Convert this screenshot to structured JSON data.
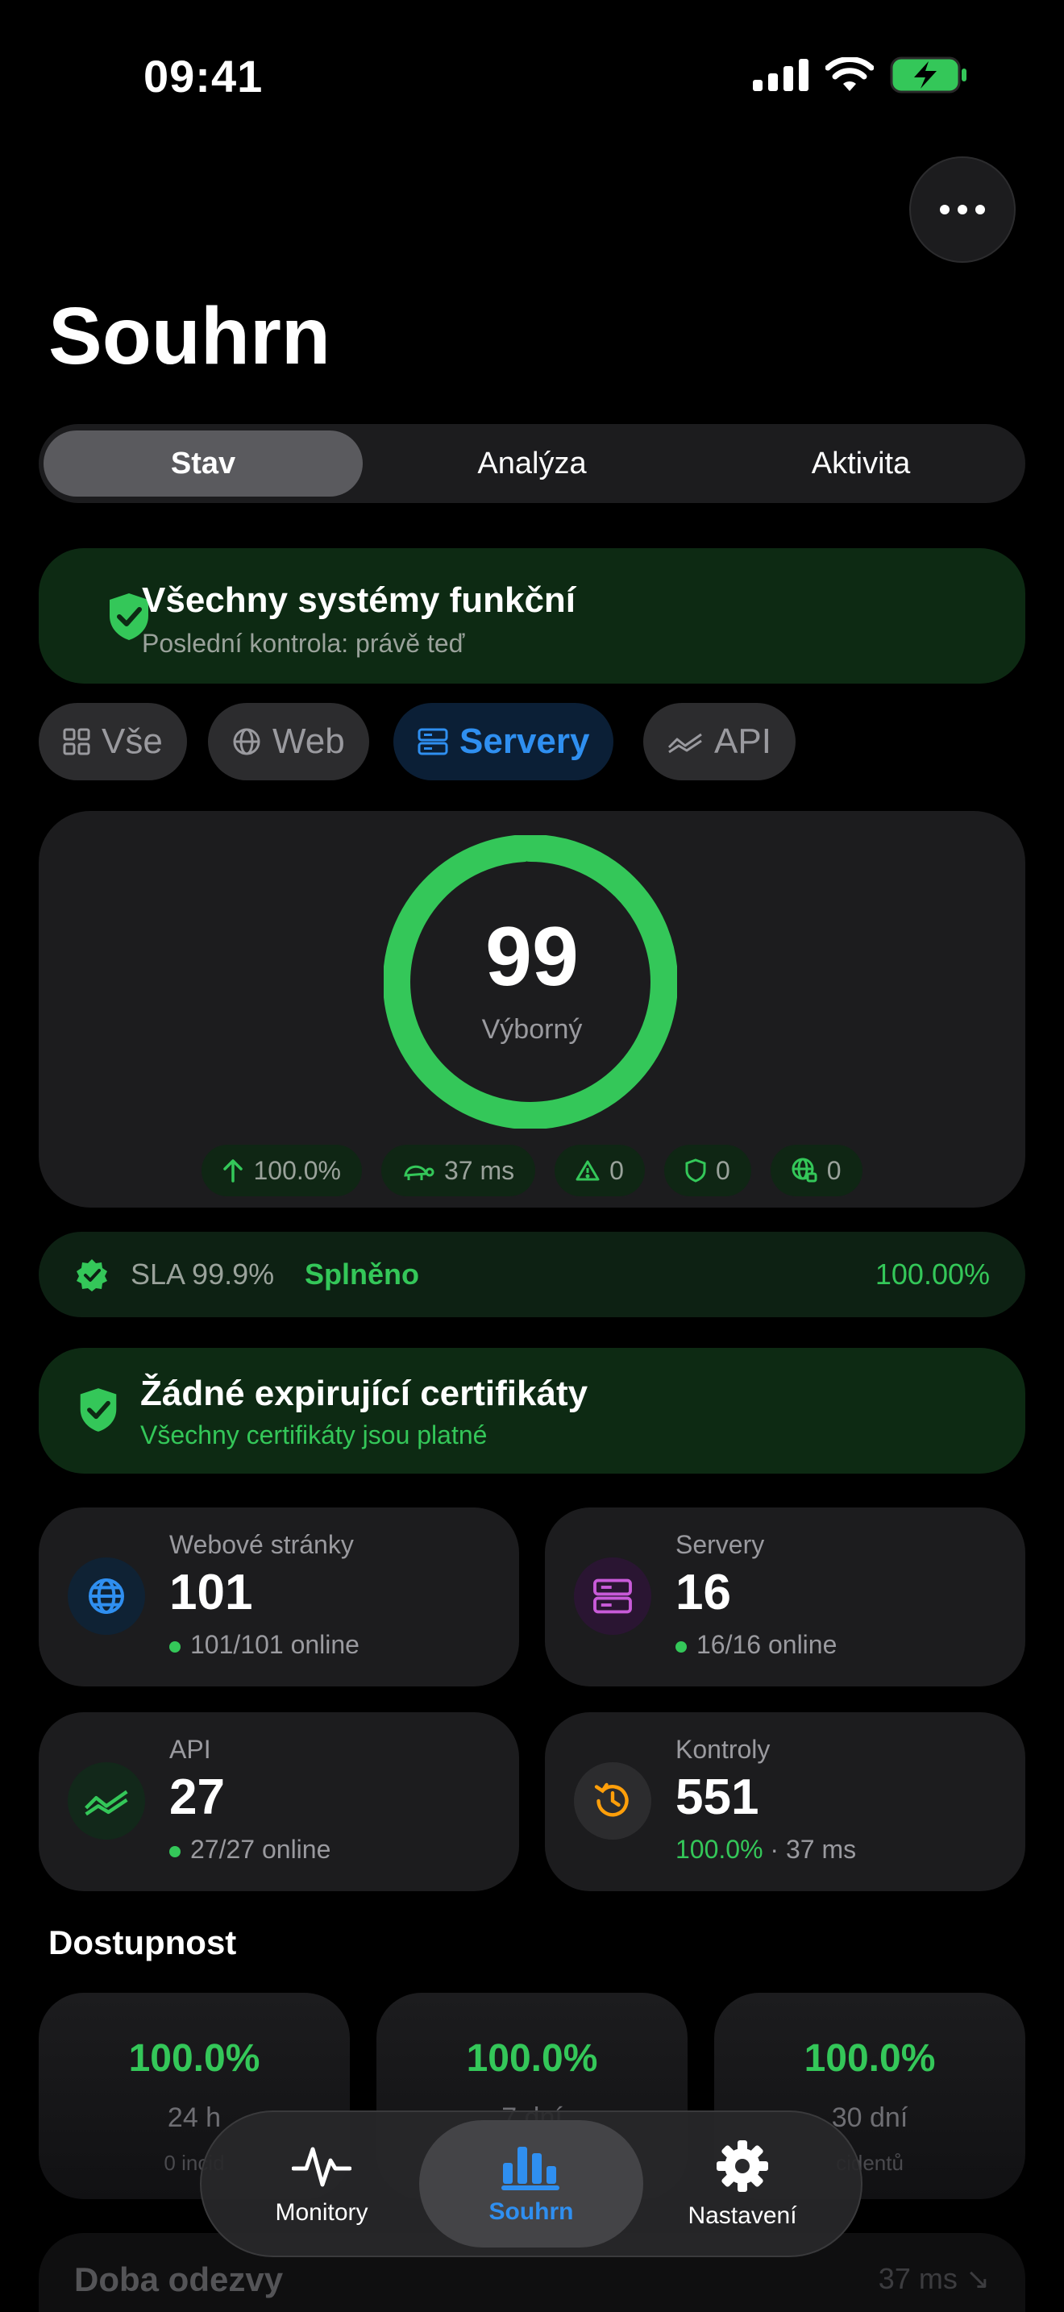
{
  "status_bar": {
    "time": "09:41"
  },
  "header": {
    "title": "Souhrn",
    "more_icon": "ellipsis-icon"
  },
  "segments": [
    {
      "label": "Stav",
      "active": true
    },
    {
      "label": "Analýza",
      "active": false
    },
    {
      "label": "Aktivita",
      "active": false
    }
  ],
  "status_banner": {
    "title": "Všechny systémy funkční",
    "subtitle": "Poslední kontrola: právě teď"
  },
  "filters": [
    {
      "label": "Vše",
      "icon": "grid-icon",
      "active": false
    },
    {
      "label": "Web",
      "icon": "globe-icon",
      "active": false
    },
    {
      "label": "Servery",
      "icon": "server-icon",
      "active": true
    },
    {
      "label": "API",
      "icon": "api-icon",
      "active": false
    }
  ],
  "health": {
    "score": "99",
    "score_label": "Výborný",
    "ring_fraction": 0.99,
    "pills": [
      {
        "icon": "arrow-up-icon",
        "value": "100.0%"
      },
      {
        "icon": "turtle-icon",
        "value": "37 ms"
      },
      {
        "icon": "warning-icon",
        "value": "0"
      },
      {
        "icon": "shield-icon",
        "value": "0"
      },
      {
        "icon": "globe-lock-icon",
        "value": "0"
      }
    ]
  },
  "sla": {
    "label": "SLA 99.9%",
    "status": "Splněno",
    "value": "100.00%"
  },
  "certificates": {
    "title": "Žádné expirující certifikáty",
    "subtitle": "Všechny certifikáty jsou platné"
  },
  "stats": {
    "websites": {
      "label": "Webové stránky",
      "value": "101",
      "sub": "101/101 online"
    },
    "servers": {
      "label": "Servery",
      "value": "16",
      "sub": "16/16 online"
    },
    "api": {
      "label": "API",
      "value": "27",
      "sub": "27/27 online"
    },
    "checks": {
      "label": "Kontroly",
      "value": "551",
      "sub_pct": "100.0%",
      "sub_rest": " · 37 ms"
    }
  },
  "availability": {
    "title": "Dostupnost",
    "items": [
      {
        "pct": "100.0%",
        "period": "24 h",
        "incidents": "0 incid"
      },
      {
        "pct": "100.0%",
        "period": "7 dní",
        "incidents": ""
      },
      {
        "pct": "100.0%",
        "period": "30 dní",
        "incidents": "cidentů"
      }
    ]
  },
  "response": {
    "title": "Doba odezvy",
    "value": "37 ms ↘"
  },
  "tabbar": [
    {
      "label": "Monitory",
      "icon": "pulse-icon",
      "active": false
    },
    {
      "label": "Souhrn",
      "icon": "chart-bars-icon",
      "active": true
    },
    {
      "label": "Nastavení",
      "icon": "gear-icon",
      "active": false
    }
  ],
  "colors": {
    "accent": "#2f8ff0",
    "success": "#34c759",
    "card": "#1c1c1e"
  }
}
